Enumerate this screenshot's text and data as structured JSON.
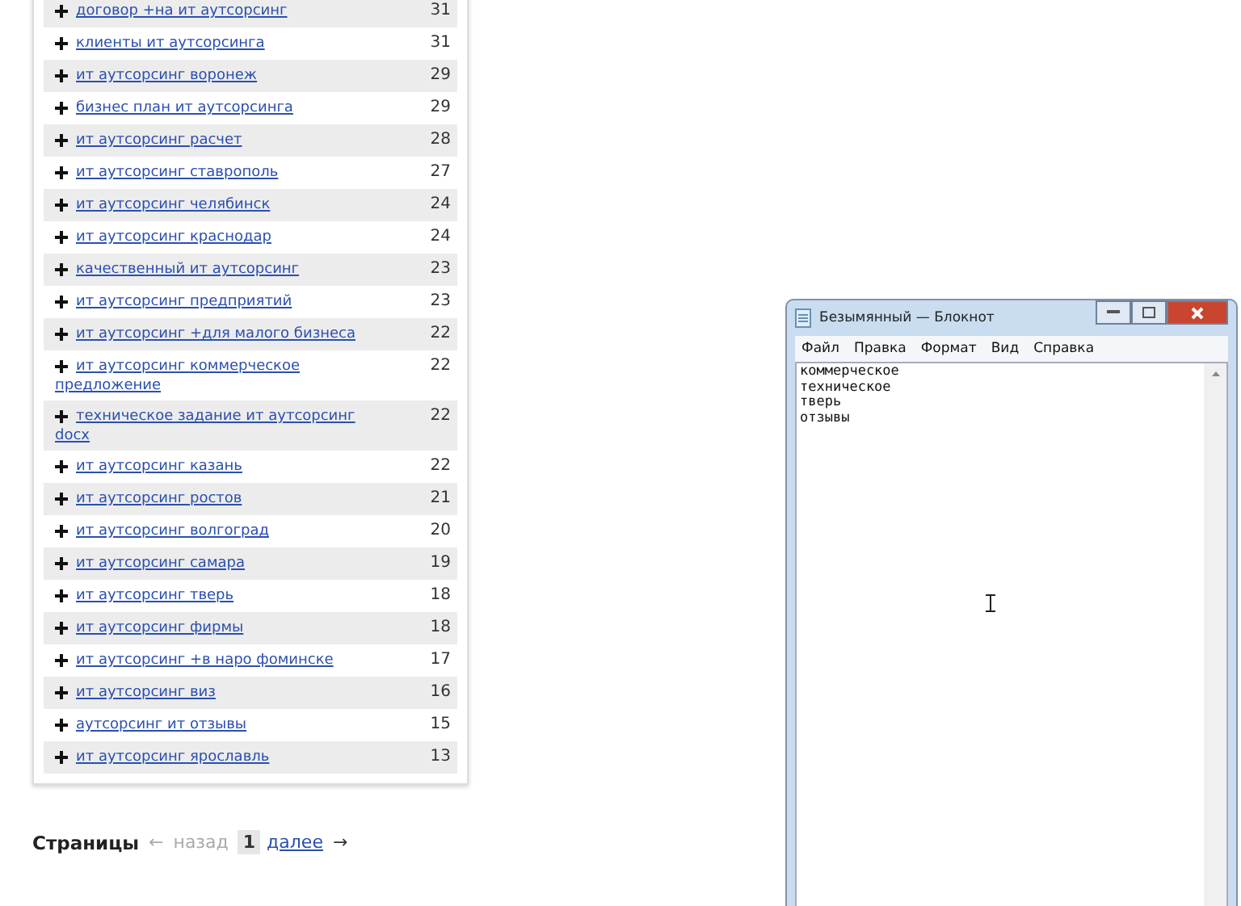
{
  "keywords": [
    {
      "phrase": "договор +на ит аутсорсинг",
      "count": "31"
    },
    {
      "phrase": "клиенты ит аутсорсинга",
      "count": "31"
    },
    {
      "phrase": "ит аутсорсинг воронеж",
      "count": "29"
    },
    {
      "phrase": "бизнес план ит аутсорсинга",
      "count": "29"
    },
    {
      "phrase": "ит аутсорсинг расчет",
      "count": "28"
    },
    {
      "phrase": "ит аутсорсинг ставрополь",
      "count": "27"
    },
    {
      "phrase": "ит аутсорсинг челябинск",
      "count": "24"
    },
    {
      "phrase": "ит аутсорсинг краснодар",
      "count": "24"
    },
    {
      "phrase": "качественный ит аутсорсинг",
      "count": "23"
    },
    {
      "phrase": "ит аутсорсинг предприятий",
      "count": "23"
    },
    {
      "phrase": "ит аутсорсинг +для малого бизнеса",
      "count": "22"
    },
    {
      "phrase": "ит аутсорсинг коммерческое предложение",
      "count": "22"
    },
    {
      "phrase": "техническое задание ит аутсорсинг docx",
      "count": "22"
    },
    {
      "phrase": "ит аутсорсинг казань",
      "count": "22"
    },
    {
      "phrase": "ит аутсорсинг ростов",
      "count": "21"
    },
    {
      "phrase": "ит аутсорсинг волгоград",
      "count": "20"
    },
    {
      "phrase": "ит аутсорсинг самара",
      "count": "19"
    },
    {
      "phrase": "ит аутсорсинг тверь",
      "count": "18"
    },
    {
      "phrase": "ит аутсорсинг фирмы",
      "count": "18"
    },
    {
      "phrase": "ит аутсорсинг +в наро фоминске",
      "count": "17"
    },
    {
      "phrase": "ит аутсорсинг виз",
      "count": "16"
    },
    {
      "phrase": "аутсорсинг ит отзывы",
      "count": "15"
    },
    {
      "phrase": "ит аутсорсинг ярославль",
      "count": "13"
    }
  ],
  "pagination": {
    "label": "Страницы",
    "prev_arrow": "←",
    "prev": "назад",
    "current": "1",
    "next": "далее",
    "next_arrow": "→"
  },
  "notepad": {
    "title": "Безымянный — Блокнот",
    "menu": [
      "Файл",
      "Правка",
      "Формат",
      "Вид",
      "Справка"
    ],
    "lines": [
      "коммерческое",
      "техническое",
      "тверь",
      "отзывы"
    ]
  }
}
